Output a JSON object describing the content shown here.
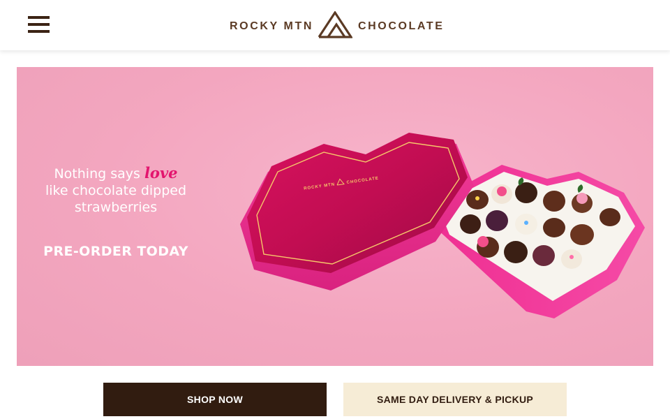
{
  "header": {
    "menu_icon": "hamburger-menu-icon",
    "logo": {
      "text_left": "ROCKY MTN",
      "text_right": "CHOCOLATE",
      "mark_icon": "mountain-logo-icon",
      "color": "#5b3a24"
    }
  },
  "hero": {
    "line1_prefix": "Nothing says ",
    "line1_emphasis": "love",
    "line2": "like chocolate dipped",
    "line3": "strawberries",
    "cta_text": "PRE-ORDER TODAY",
    "image": "heart-shaped-box-with-chocolate-dipped-strawberries",
    "box_logo_text": "ROCKY MTN CHOCOLATE",
    "background_color": "#f3a6bf",
    "accent_color": "#e3156e"
  },
  "buttons": {
    "shop_now": "SHOP NOW",
    "same_day": "SAME DAY DELIVERY & PICKUP"
  },
  "colors": {
    "brand_brown": "#311c10",
    "cream": "#f6ecd6"
  }
}
